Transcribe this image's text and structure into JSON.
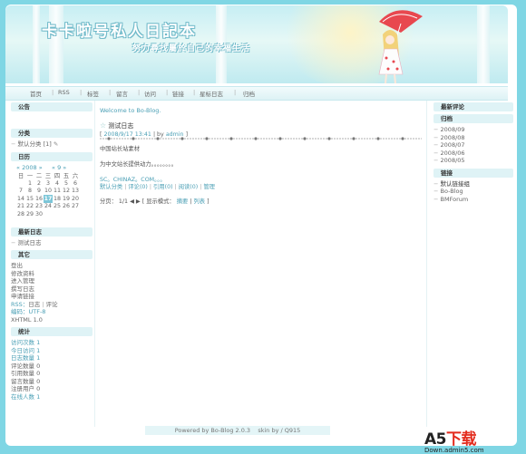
{
  "banner": {
    "title": "卡卡啦号私人日記本",
    "subtitle": "努力尋找屬於自己的幸福生活"
  },
  "nav": [
    "首页",
    "RSS",
    "标签",
    "留言",
    "访问",
    "链接",
    "星标日志",
    "归档"
  ],
  "left": {
    "announce_h": "公告",
    "category_h": "分类",
    "category_item": "默认分类",
    "category_count": "[1]",
    "calendar_h": "日历",
    "calendar_nav": {
      "prev_year": "«",
      "year": "2008",
      "next_year": "»",
      "prev_month": "«",
      "month": "9",
      "next_month": "»"
    },
    "weekdays": [
      "日",
      "一",
      "二",
      "三",
      "四",
      "五",
      "六"
    ],
    "weeks": [
      [
        "",
        "1",
        "2",
        "3",
        "4",
        "5",
        "6"
      ],
      [
        "7",
        "8",
        "9",
        "10",
        "11",
        "12",
        "13"
      ],
      [
        "14",
        "15",
        "16",
        "17",
        "18",
        "19",
        "20"
      ],
      [
        "21",
        "22",
        "23",
        "24",
        "25",
        "26",
        "27"
      ],
      [
        "28",
        "29",
        "30",
        "",
        "",
        "",
        ""
      ]
    ],
    "today": "17",
    "recent_h": "最新日志",
    "recent_item": "测试日志",
    "other_h": "其它",
    "other_items": [
      "登出",
      "修改资料",
      "进入管理",
      "撰写日志",
      "申请链接"
    ],
    "rss_line": {
      "rss": "RSS：",
      "posts": "日志",
      "bar": "|",
      "comments": "评论"
    },
    "encoding": "编码：UTF-8",
    "xhtml": "XHTML 1.0",
    "stats_h": "统计",
    "stats": [
      {
        "label": "访问次数",
        "value": "1",
        "blue": true
      },
      {
        "label": "今日访问",
        "value": "1",
        "blue": true
      },
      {
        "label": "日志数量",
        "value": "1",
        "blue": true
      },
      {
        "label": "评论数量",
        "value": "0",
        "blue": false
      },
      {
        "label": "引用数量",
        "value": "0",
        "blue": false
      },
      {
        "label": "留言数量",
        "value": "0",
        "blue": false
      },
      {
        "label": "注册用户",
        "value": "0",
        "blue": false
      },
      {
        "label": "在线人数",
        "value": "1",
        "blue": true
      }
    ]
  },
  "main": {
    "welcome": "Welcome to Bo-Blog.",
    "post_title": "测试日志",
    "meta_open": "[",
    "meta_date": "2008/9/17 13:41",
    "meta_by": "| by",
    "meta_author": "admin",
    "meta_close": "]",
    "line1": "中国站长站素材",
    "line2": "为中文站长提供动力。。。。。。。。",
    "line3": "SC。CHINAZ。COM。。。",
    "links": {
      "category": "默认分类",
      "comments": "评论(0)",
      "trackback": "引用(0)",
      "reads": "阅读(0)",
      "manage": "管理"
    },
    "pager": {
      "label": "分页：",
      "page": "1/1",
      "mode_open": "[ 显示模式：",
      "summary": "摘要",
      "bar": "|",
      "list": "列表",
      "mode_close": "]"
    }
  },
  "right": {
    "latest_comments_h": "最新评论",
    "archive_h": "归档",
    "archives": [
      "2008/09",
      "2008/08",
      "2008/07",
      "2008/06",
      "2008/05"
    ],
    "links_h": "链接",
    "link_group": "默认链接组",
    "links": [
      "Bo-Blog",
      "BMForum"
    ]
  },
  "footer": {
    "powered": "Powered by Bo-Blog 2.0.3",
    "skin": "skin by / Q915"
  },
  "watermark": {
    "a5": "A5",
    "xz": "下载",
    "url": "Down.admin5.com"
  },
  "colors": {
    "accent": "#4a9fb5",
    "frame": "#7fd6e4",
    "today": "#7cc6d8"
  }
}
